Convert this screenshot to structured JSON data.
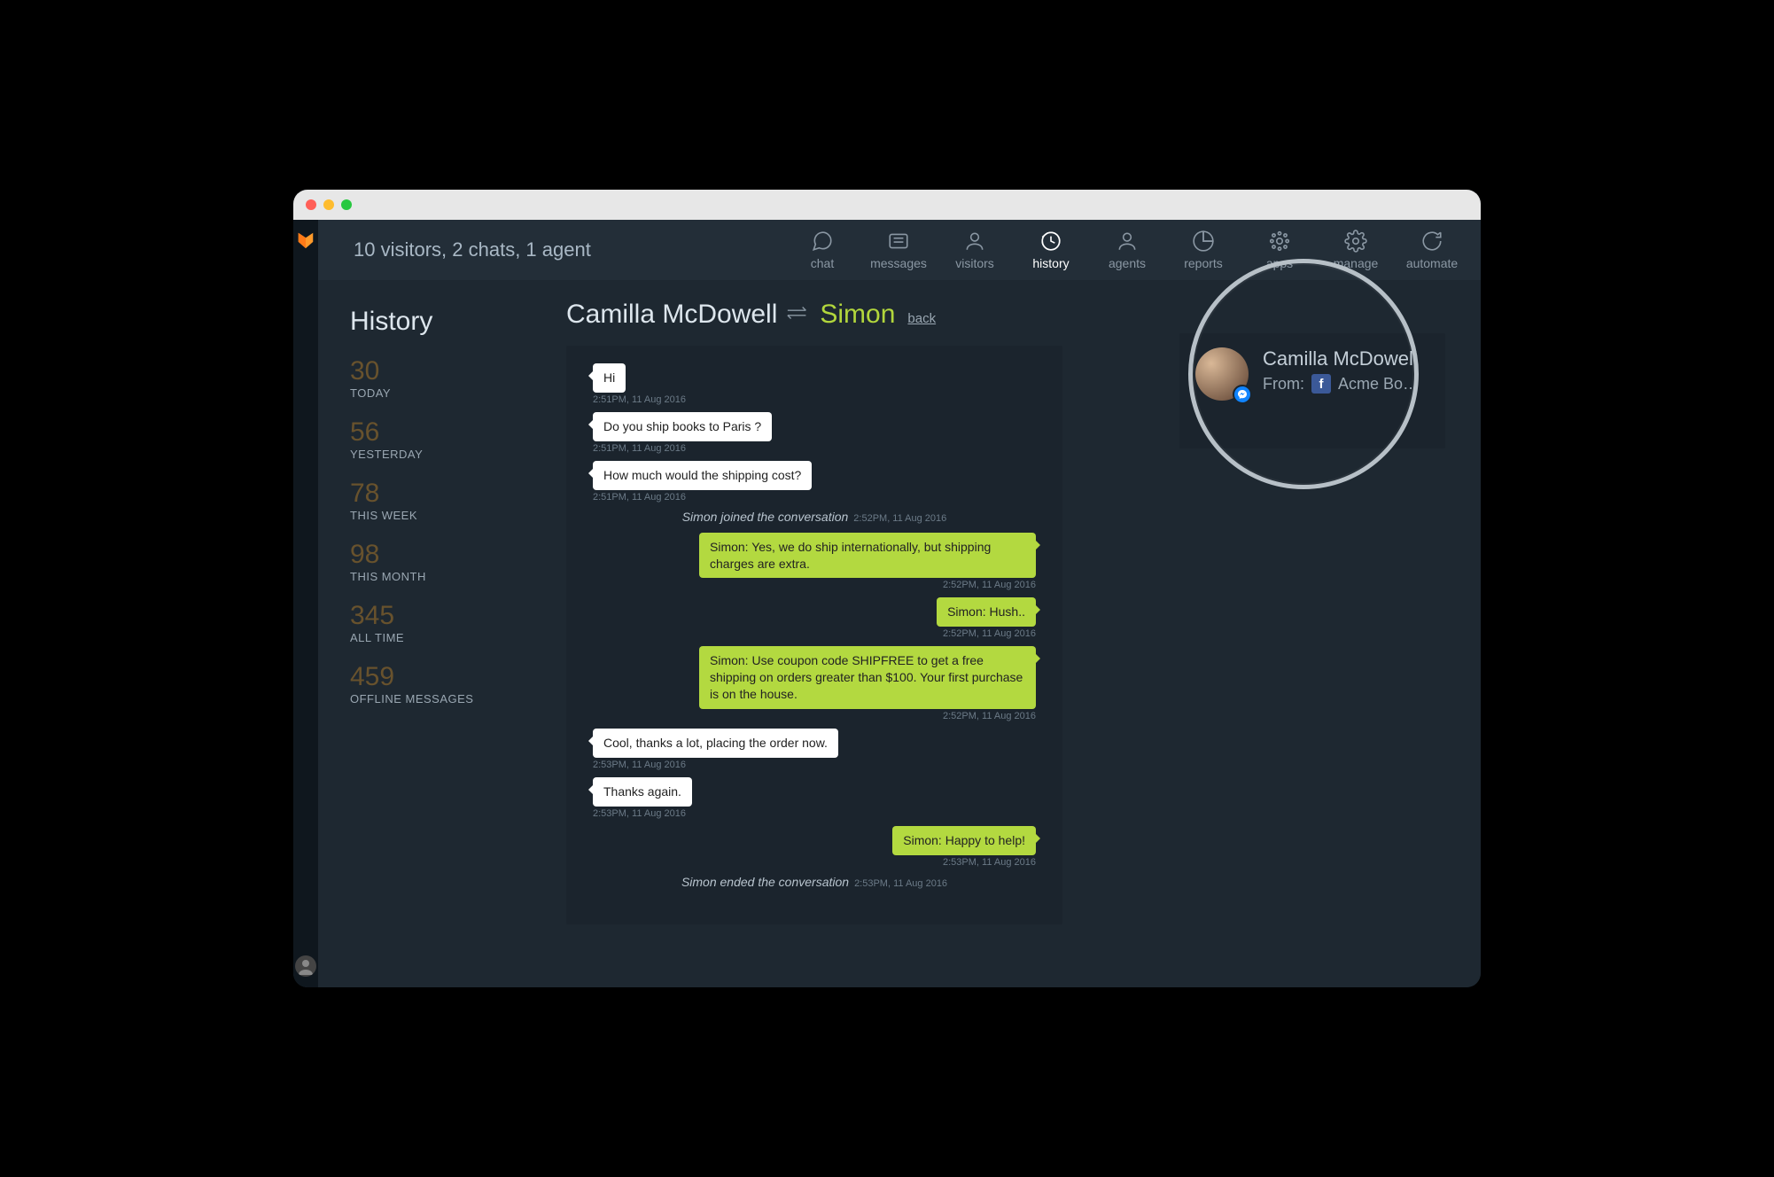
{
  "header": {
    "stats_text": "10 visitors, 2 chats, 1 agent"
  },
  "nav": [
    {
      "id": "chat",
      "label": "chat"
    },
    {
      "id": "messages",
      "label": "messages"
    },
    {
      "id": "visitors",
      "label": "visitors"
    },
    {
      "id": "history",
      "label": "history",
      "active": true
    },
    {
      "id": "agents",
      "label": "agents"
    },
    {
      "id": "reports",
      "label": "reports"
    },
    {
      "id": "apps",
      "label": "apps"
    },
    {
      "id": "manage",
      "label": "manage"
    },
    {
      "id": "automate",
      "label": "automate"
    }
  ],
  "sidebar": {
    "title": "History",
    "stats": [
      {
        "num": "30",
        "label": "TODAY"
      },
      {
        "num": "56",
        "label": "YESTERDAY"
      },
      {
        "num": "78",
        "label": "THIS WEEK"
      },
      {
        "num": "98",
        "label": "THIS MONTH"
      },
      {
        "num": "345",
        "label": "ALL TIME"
      },
      {
        "num": "459",
        "label": "OFFLINE MESSAGES"
      }
    ]
  },
  "conversation": {
    "visitor_name": "Camilla McDowell",
    "agent_name": "Simon",
    "back_label": "back",
    "messages": [
      {
        "type": "visitor",
        "text": "Hi",
        "ts": "2:51PM, 11 Aug 2016"
      },
      {
        "type": "visitor",
        "text": "Do you ship books to Paris ?",
        "ts": "2:51PM, 11 Aug 2016"
      },
      {
        "type": "visitor",
        "text": "How much would the shipping cost?",
        "ts": "2:51PM, 11 Aug 2016"
      },
      {
        "type": "system",
        "text": "Simon joined the conversation",
        "ts": "2:52PM, 11 Aug 2016"
      },
      {
        "type": "agent",
        "text": "Simon: Yes, we do ship internationally, but shipping charges are extra.",
        "ts": "2:52PM, 11 Aug 2016"
      },
      {
        "type": "agent",
        "text": "Simon: Hush..",
        "ts": "2:52PM, 11 Aug 2016"
      },
      {
        "type": "agent",
        "text": "Simon: Use coupon code SHIPFREE to get a free shipping on orders greater than $100. Your first purchase is on the house.",
        "ts": "2:52PM, 11 Aug 2016"
      },
      {
        "type": "visitor",
        "text": "Cool, thanks a lot, placing the order now.",
        "ts": "2:53PM, 11 Aug 2016"
      },
      {
        "type": "visitor",
        "text": "Thanks again.",
        "ts": "2:53PM, 11 Aug 2016"
      },
      {
        "type": "agent",
        "text": "Simon: Happy to help!",
        "ts": "2:53PM, 11 Aug 2016"
      },
      {
        "type": "system",
        "text": "Simon ended the conversation",
        "ts": "2:53PM, 11 Aug 2016"
      }
    ]
  },
  "visitor_card": {
    "name": "Camilla McDowell",
    "from_label": "From:",
    "source": "Acme Book S…"
  }
}
